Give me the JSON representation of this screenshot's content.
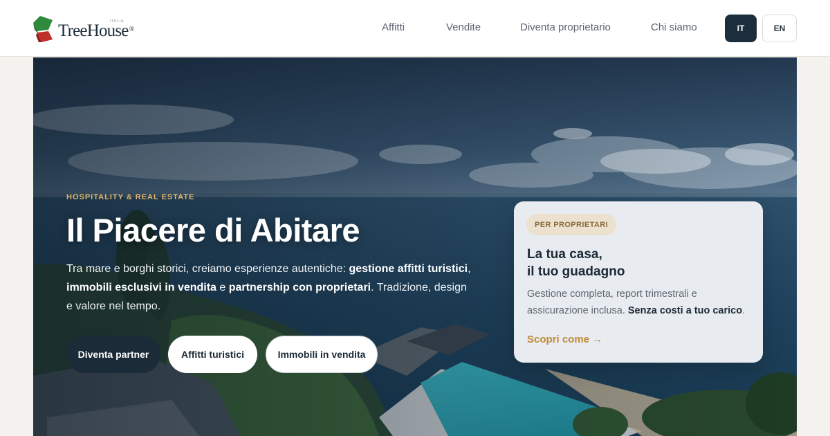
{
  "brand": {
    "name": "TreeHouse",
    "registered": "®",
    "sub": "ITALIA",
    "colors": {
      "green": "#2e8b3e",
      "red": "#c0302b",
      "dark": "#1c2e3b",
      "gold": "#c08a3a"
    }
  },
  "nav": {
    "items": [
      {
        "label": "Affitti"
      },
      {
        "label": "Vendite"
      },
      {
        "label": "Diventa proprietario"
      },
      {
        "label": "Chi siamo"
      }
    ]
  },
  "lang": {
    "it": "IT",
    "en": "EN",
    "selected": "IT"
  },
  "hero": {
    "eyebrow": "HOSPITALITY & REAL ESTATE",
    "title": "Il Piacere di Abitare",
    "desc": {
      "t1": "Tra mare e borghi storici, creiamo esperienze autentiche: ",
      "b1": "gestione affitti turistici",
      "t2": ", ",
      "b2": "immobili esclusivi in vendita",
      "t3": " e ",
      "b3": "partnership con proprietari",
      "t4": ". Tradizione, design e valore nel tempo."
    },
    "buttons": {
      "partner": "Diventa partner",
      "affitti": "Affitti turistici",
      "vendita": "Immobili in vendita"
    }
  },
  "card": {
    "badge": "PER PROPRIETARI",
    "title_line1": "La tua casa,",
    "title_line2": "il tuo guadagno",
    "text": "Gestione completa, report trimestrali e assicurazione inclusa. ",
    "text_bold": "Senza costi a tuo carico",
    "text_end": ".",
    "link": "Scopri come →"
  }
}
